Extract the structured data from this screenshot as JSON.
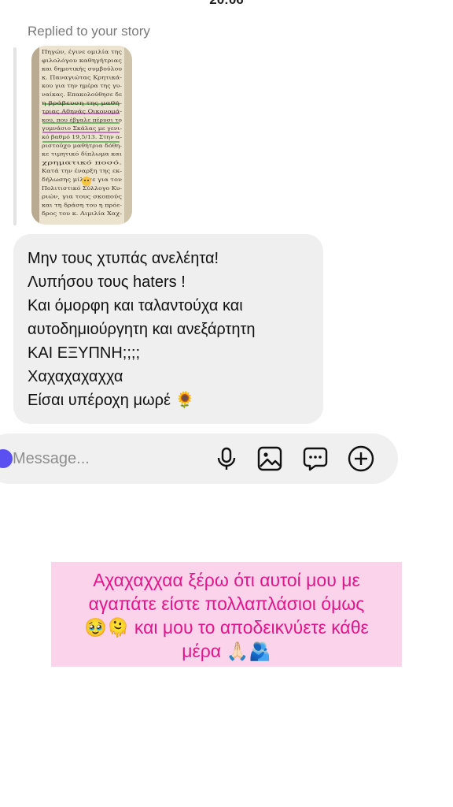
{
  "status": {
    "time_partial": "20:06"
  },
  "thread": {
    "replied_label": "Replied to your story",
    "story_thumbnail": {
      "lines": [
        "Πηγών, έγινε ομιλία της",
        "φιλολόγου καθηγήτριας",
        "και δημοτικής συμβούλου",
        "κ. Παναγιώτας Κρητικά-",
        "κου για την ημέρα της γυ-",
        "ναίκας. Επακολούθησε δε",
        "η βράβευση της μαθή-",
        "τριας Αθηνάς Οικονομά-",
        "κου, που έβγαλε πέρυσι το",
        "γυμνάσιο Σκάλας με γενι-",
        "κό βαθμό 19,5/13. Στην α-",
        "ριστούχο μαθήτρια δόθη-",
        "κε τιμητικό δίπλωμα και",
        "χρηματικό ποσό.",
        "Κατά την έναρξη της εκ-",
        "δήλωσης μίλησε για τον",
        "Πολιτιστικό Σύλλογο Κυ-",
        "ριών, για τους σκοπούς",
        "και τη δράση του η πρόε-",
        "δρος του κ. Αιμιλία Χαχ-"
      ]
    },
    "message_lines": [
      "Μην τους χτυπάς  ανελέητα!",
      "Λυπήσου τους haters !",
      "Και όμορφη και ταλαντούχα και",
      "αυτοδημιούργητη και ανεξάρτητη",
      "ΚΑΙ ΕΞΥΠΝΗ;;;;",
      "Χαχαχαχαχχα",
      "Είσαι υπέροχη μωρέ 🌻"
    ]
  },
  "composer": {
    "placeholder": "Message...",
    "icons": [
      "microphone-icon",
      "image-icon",
      "sticker-chat-icon",
      "add-circle-icon"
    ]
  },
  "caption": {
    "lines": [
      "Αχαχαχχαα ξέρω ότι αυτοί μου με",
      "αγαπάτε είστε πολλαπλάσιοι όμως",
      "🥹🫠 και μου το αποδεικνύετε κάθε",
      "μέρα 🙏🏻🫂"
    ]
  },
  "colors": {
    "bubble_bg": "#efefef",
    "caption_bg": "#fbd3ea",
    "caption_text": "#e0168a",
    "replied_text": "#7a7a7a"
  }
}
